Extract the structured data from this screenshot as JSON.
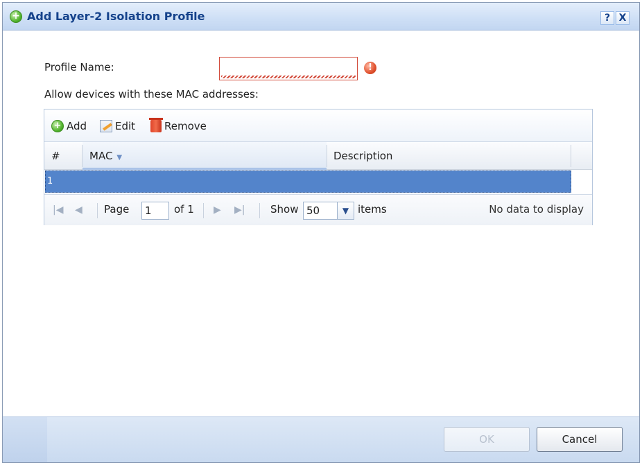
{
  "dialog": {
    "title": "Add Layer-2 Isolation Profile",
    "help_label": "?",
    "close_label": "X"
  },
  "form": {
    "profile_name_label": "Profile Name:",
    "profile_name_value": "",
    "allow_label": "Allow devices with these MAC addresses:"
  },
  "toolbar": {
    "add_label": "Add",
    "edit_label": "Edit",
    "remove_label": "Remove"
  },
  "table": {
    "columns": [
      "#",
      "MAC",
      "Description"
    ],
    "rows": [
      {
        "index": "1",
        "mac": "",
        "description": ""
      }
    ]
  },
  "pager": {
    "page_label": "Page",
    "page_value": "1",
    "of_label": "of 1",
    "show_label": "Show",
    "show_value": "50",
    "items_label": "items",
    "status": "No data to display"
  },
  "footer": {
    "ok_label": "OK",
    "cancel_label": "Cancel"
  },
  "colors": {
    "title": "#15428b",
    "selected_row": "#5384cb",
    "error": "#d24a3a"
  }
}
